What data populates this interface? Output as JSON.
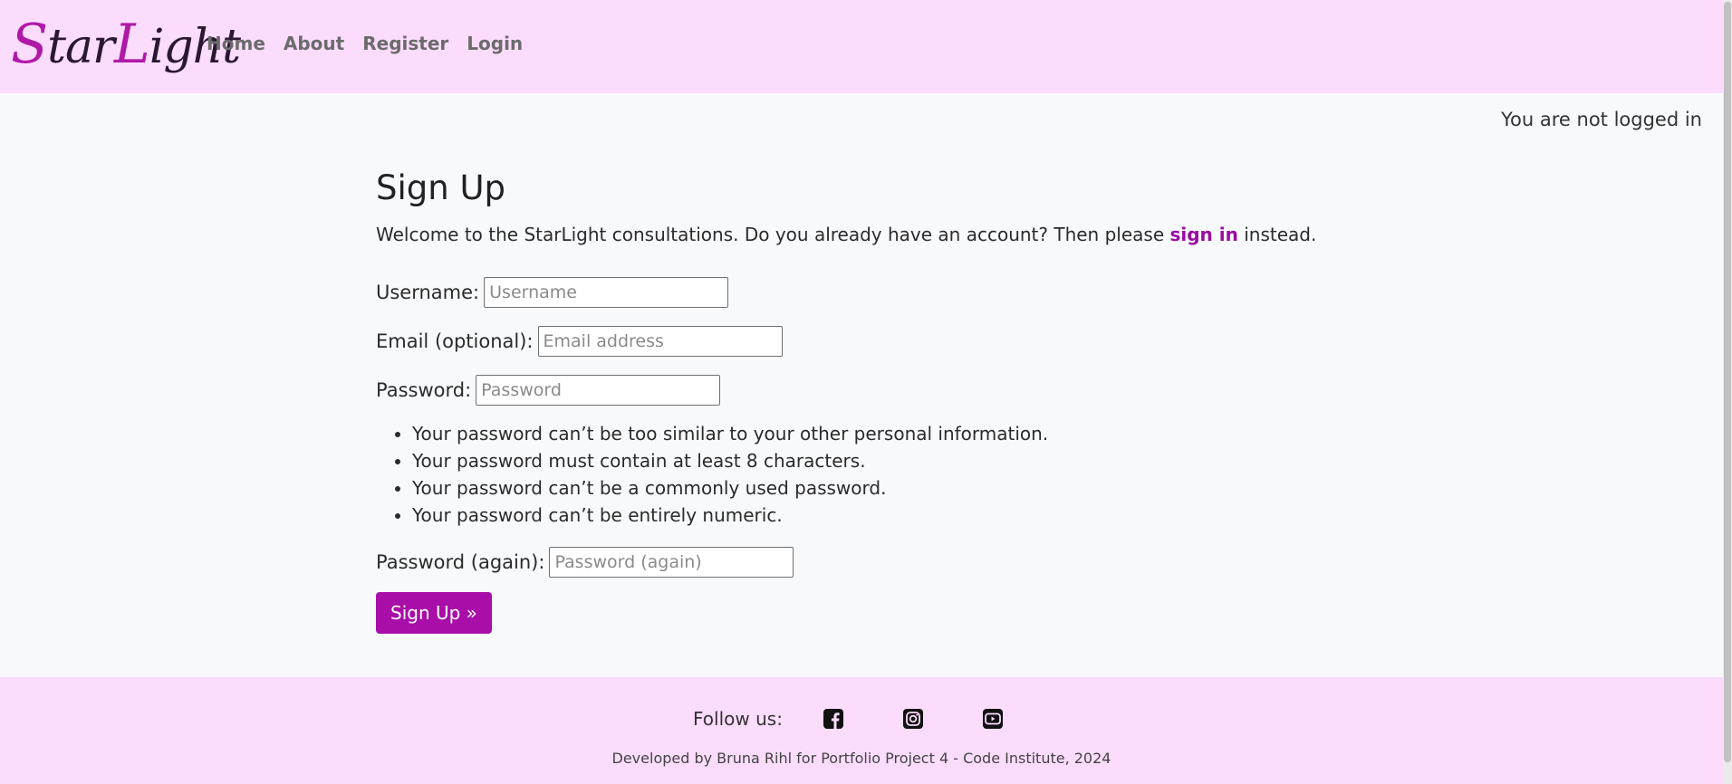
{
  "nav": {
    "logo_first": "S",
    "logo_mid": "tar",
    "logo_second": "L",
    "logo_rest": "ight",
    "links": [
      "Home",
      "About",
      "Register",
      "Login"
    ]
  },
  "status": "You are not logged in",
  "signup": {
    "title": "Sign Up",
    "intro_before": "Welcome to the StarLight consultations. Do you already have an account? Then please ",
    "intro_link": "sign in",
    "intro_after": " instead.",
    "username_label": "Username:",
    "username_placeholder": "Username",
    "email_label": "Email (optional):",
    "email_placeholder": "Email address",
    "password_label": "Password:",
    "password_placeholder": "Password",
    "password_help": [
      "Your password can’t be too similar to your other personal information.",
      "Your password must contain at least 8 characters.",
      "Your password can’t be a commonly used password.",
      "Your password can’t be entirely numeric."
    ],
    "password2_label": "Password (again):",
    "password2_placeholder": "Password (again)",
    "submit_label": "Sign Up »"
  },
  "footer": {
    "follow_label": "Follow us:",
    "icons": [
      "facebook-icon",
      "instagram-icon",
      "youtube-icon"
    ],
    "credit": "Developed by Bruna Rihl for Portfolio Project 4 - Code Institute, 2024"
  },
  "colors": {
    "nav_bg": "#fbdcfd",
    "accent": "#a90ea9"
  }
}
